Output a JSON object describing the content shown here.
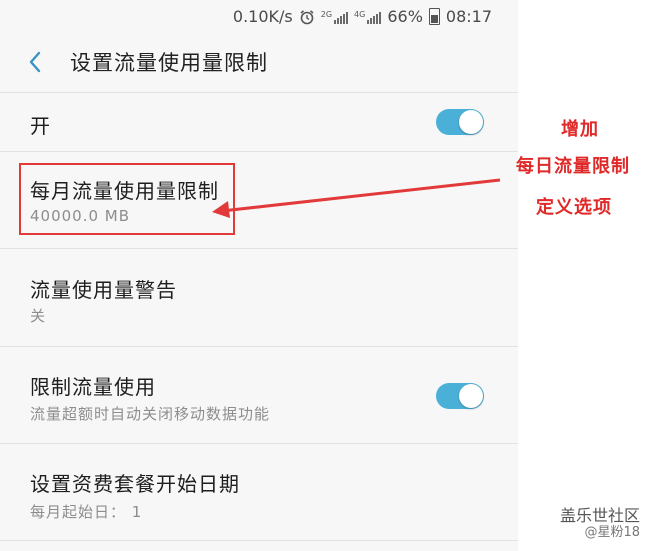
{
  "status_bar": {
    "speed": "0.10K/s",
    "net1": "2G",
    "net2": "4G",
    "battery": "66%",
    "time": "08:17"
  },
  "header": {
    "title": "设置流量使用量限制"
  },
  "settings": {
    "on_row": {
      "title": "开",
      "enabled": true
    },
    "monthly_limit": {
      "title": "每月流量使用量限制",
      "value": "40000.0 MB"
    },
    "usage_warning": {
      "title": "流量使用量警告",
      "value": "关"
    },
    "limit_usage": {
      "title": "限制流量使用",
      "desc": "流量超额时自动关闭移动数据功能",
      "enabled": true
    },
    "billing_start": {
      "title": "设置资费套餐开始日期",
      "value": "每月起始日： 1"
    }
  },
  "annotation": {
    "line1": "增加",
    "line2": "每日流量限制",
    "line3": "定义选项",
    "color": "#e02a2a"
  },
  "watermark": {
    "line1": "盖乐世社区",
    "line2": "@星粉18"
  },
  "colors": {
    "toggle_on": "#4bb0d8",
    "back_arrow": "#3a93c4",
    "background": "#f7f7f7"
  }
}
